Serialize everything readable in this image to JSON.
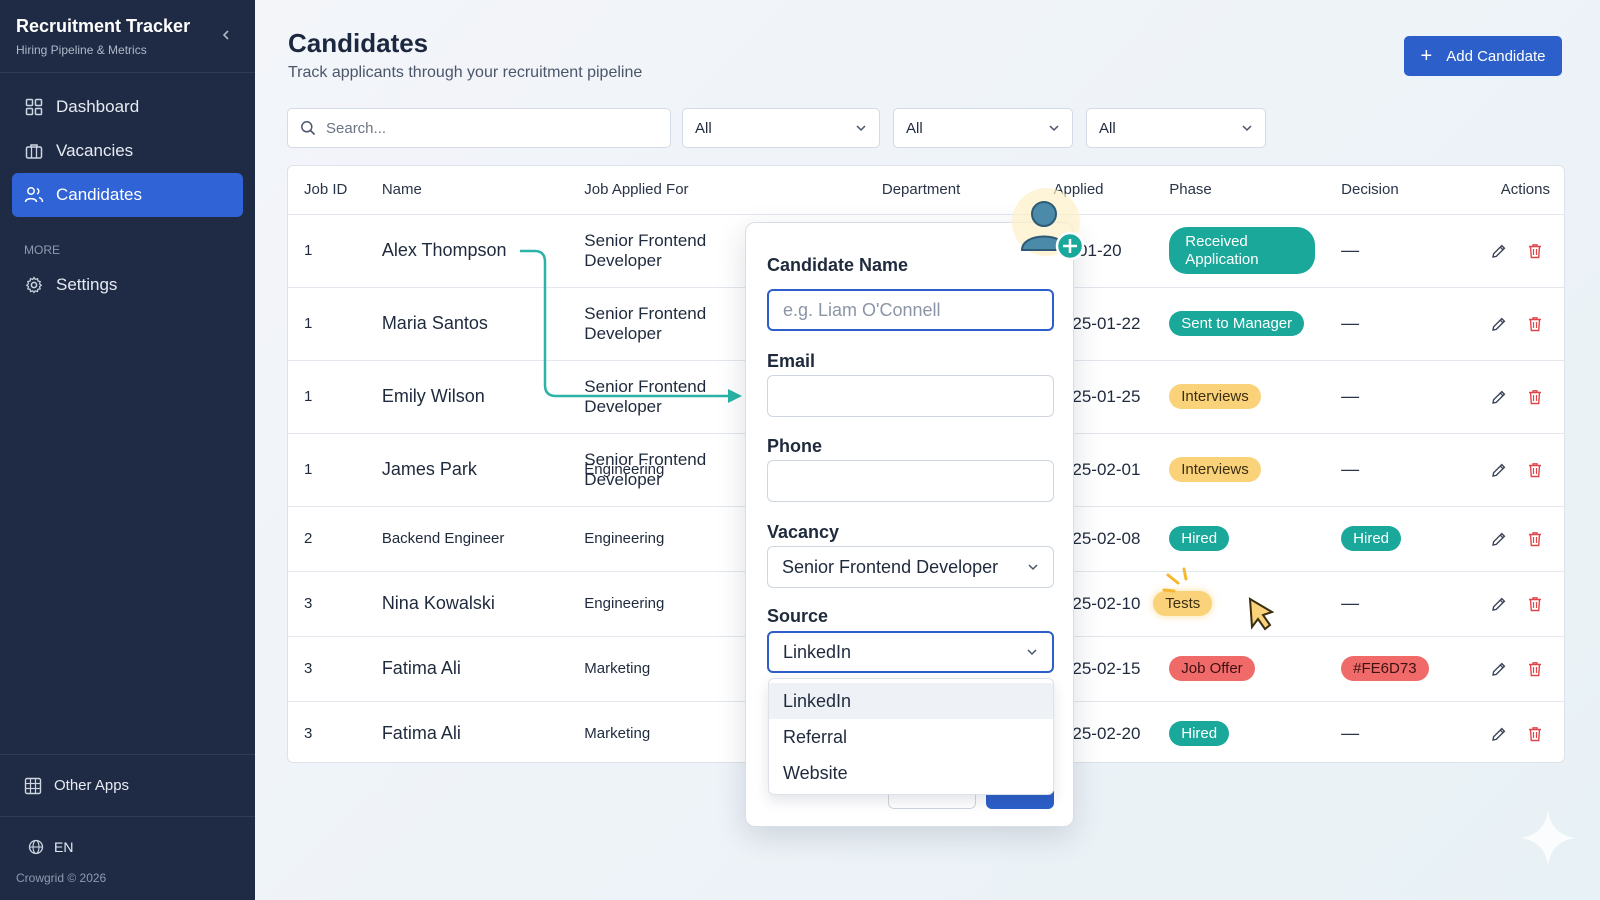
{
  "sidebar": {
    "title": "Recruitment Tracker",
    "subtitle": "Hiring Pipeline & Metrics",
    "nav": [
      {
        "label": "Dashboard",
        "icon": "dashboard-grid-icon"
      },
      {
        "label": "Vacancies",
        "icon": "briefcase-icon"
      },
      {
        "label": "Candidates",
        "icon": "users-icon",
        "active": true
      }
    ],
    "section_more": "MORE",
    "settings_label": "Settings",
    "other_apps_label": "Other Apps",
    "language": "EN",
    "copyright": "Crowgrid © 2026"
  },
  "header": {
    "title": "Candidates",
    "subtitle": "Track applicants through your recruitment pipeline",
    "add_button": "Add Candidate"
  },
  "filters": {
    "search_placeholder": "Search...",
    "filter1": "All",
    "filter2": "All",
    "filter3": "All"
  },
  "table": {
    "columns": [
      "Job ID",
      "Name",
      "Job Applied For",
      "Department",
      "Applied",
      "Phase",
      "Decision",
      "Actions"
    ],
    "rows": [
      {
        "job_id": "1",
        "name": "Alex Thompson",
        "job": "Senior Frontend Developer",
        "department": "",
        "applied": "25-01-20",
        "phase": "Received Application",
        "decision": "—"
      },
      {
        "job_id": "1",
        "name": "Maria Santos",
        "job": "Senior Frontend Developer",
        "department": "",
        "applied": "2025-01-22",
        "phase": "Sent to Manager",
        "decision": "—"
      },
      {
        "job_id": "1",
        "name": "Emily Wilson",
        "job": "Senior Frontend Developer",
        "department": "",
        "applied": "2025-01-25",
        "phase": "Interviews",
        "decision": "—"
      },
      {
        "job_id": "1",
        "name": "James Park",
        "job": "Senior Frontend Developer",
        "job_overlap": "Engineering",
        "department": "",
        "applied": "2025-02-01",
        "phase": "Interviews",
        "decision": "—"
      },
      {
        "job_id": "2",
        "name": "Backend Engineer",
        "job": "Engineering",
        "department": "",
        "applied": "2025-02-08",
        "phase": "Hired",
        "decision": "Hired"
      },
      {
        "job_id": "3",
        "name": "Nina Kowalski",
        "job": "Engineering",
        "department": "",
        "applied": "2025-02-10",
        "phase": "Tests",
        "decision": "—"
      },
      {
        "job_id": "3",
        "name": "Fatima Ali",
        "job": "Marketing",
        "department": "",
        "applied": "2025-02-15",
        "phase": "Job Offer",
        "decision": "#FE6D73"
      },
      {
        "job_id": "3",
        "name": "Fatima Ali",
        "job": "Marketing",
        "department": "",
        "applied": "2025-02-20",
        "phase": "Hired",
        "decision": "—"
      }
    ]
  },
  "modal": {
    "name_label": "Candidate Name",
    "name_placeholder": "e.g. Liam O'Connell",
    "email_label": "Email",
    "phone_label": "Phone",
    "vacancy_label": "Vacancy",
    "vacancy_value": "Senior Frontend Developer",
    "source_label": "Source",
    "source_value": "LinkedIn",
    "source_options": [
      "LinkedIn",
      "Referral",
      "Website"
    ]
  },
  "colors": {
    "sidebar_bg": "#1f2b44",
    "accent": "#2c5fc9",
    "teal": "#1aa89a",
    "amber": "#f9d27a",
    "red": "#f06a6a"
  }
}
